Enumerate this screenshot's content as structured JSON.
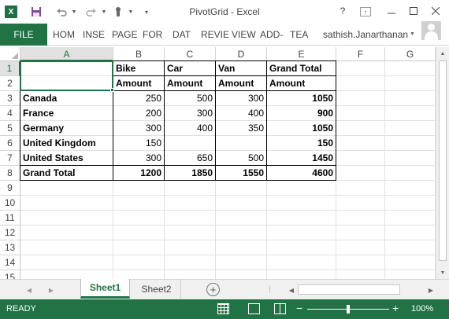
{
  "titlebar": {
    "title": "PivotGrid - Excel",
    "app_icon_text": "X",
    "help_label": "?",
    "icons": [
      "excel-icon",
      "save-icon",
      "undo-icon",
      "redo-icon",
      "touch-mode-icon",
      "customize-qat-icon",
      "help-icon",
      "ribbon-display-options-icon",
      "minimize-icon",
      "maximize-icon",
      "close-icon"
    ]
  },
  "ribbon": {
    "file_label": "FILE",
    "tabs": [
      "HOM",
      "INSE",
      "PAGE",
      "FOR",
      "DAT",
      "REVIE",
      "VIEW",
      "ADD-",
      "TEA"
    ],
    "user_name": "sathish.Janarthanan"
  },
  "grid": {
    "columns": [
      "A",
      "B",
      "C",
      "D",
      "E",
      "F",
      "G"
    ],
    "rows": [
      "1",
      "2",
      "3",
      "4",
      "5",
      "6",
      "7",
      "8",
      "9",
      "10",
      "11",
      "12",
      "13",
      "14",
      "15"
    ],
    "selected_cell": "A1",
    "cells": {
      "B1": "Bike",
      "C1": "Car",
      "D1": "Van",
      "E1": "Grand Total",
      "B2": "Amount",
      "C2": "Amount",
      "D2": "Amount",
      "E2": "Amount",
      "A3": "Canada",
      "B3": "250",
      "C3": "500",
      "D3": "300",
      "E3": "1050",
      "A4": "France",
      "B4": "200",
      "C4": "300",
      "D4": "400",
      "E4": "900",
      "A5": "Germany",
      "B5": "300",
      "C5": "400",
      "D5": "350",
      "E5": "1050",
      "A6": "United Kingdom",
      "B6": "150",
      "E6": "150",
      "A7": "United States",
      "B7": "300",
      "C7": "650",
      "D7": "500",
      "E7": "1450",
      "A8": "Grand Total",
      "B8": "1200",
      "C8": "1850",
      "D8": "1550",
      "E8": "4600"
    }
  },
  "sheets": {
    "tabs": [
      "Sheet1",
      "Sheet2"
    ],
    "active": "Sheet1",
    "add_label": "+"
  },
  "status": {
    "text": "READY",
    "zoom_minus": "−",
    "zoom_plus": "+",
    "zoom_level": "100%",
    "zoom_fraction": 0.5
  },
  "colors": {
    "accent": "#217346",
    "header_selected": "#e1e1e1"
  }
}
